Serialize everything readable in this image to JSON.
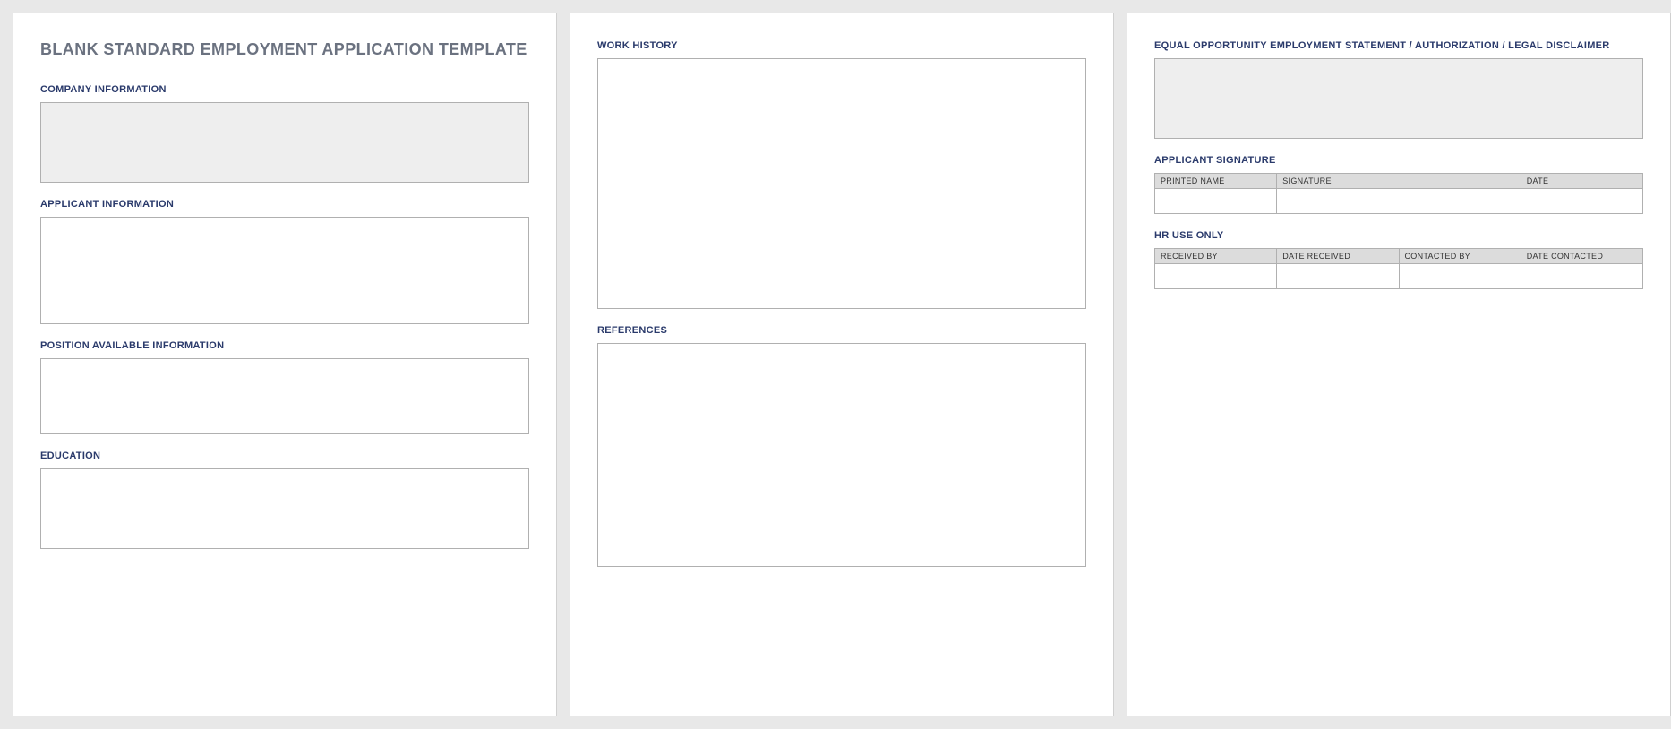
{
  "doc_title": "BLANK STANDARD EMPLOYMENT APPLICATION TEMPLATE",
  "page1": {
    "company_info_label": "COMPANY INFORMATION",
    "applicant_info_label": "APPLICANT INFORMATION",
    "position_label": "POSITION AVAILABLE INFORMATION",
    "education_label": "EDUCATION"
  },
  "page2": {
    "work_history_label": "WORK HISTORY",
    "references_label": "REFERENCES"
  },
  "page3": {
    "legal_label": "EQUAL OPPORTUNITY EMPLOYMENT STATEMENT / AUTHORIZATION / LEGAL DISCLAIMER",
    "signature_label": "APPLICANT SIGNATURE",
    "hr_label": "HR USE ONLY",
    "sig_table": {
      "headers": [
        "PRINTED NAME",
        "SIGNATURE",
        "DATE"
      ],
      "values": [
        "",
        "",
        ""
      ]
    },
    "hr_table": {
      "headers": [
        "RECEIVED BY",
        "DATE RECEIVED",
        "CONTACTED BY",
        "DATE CONTACTED"
      ],
      "values": [
        "",
        "",
        "",
        ""
      ]
    }
  }
}
